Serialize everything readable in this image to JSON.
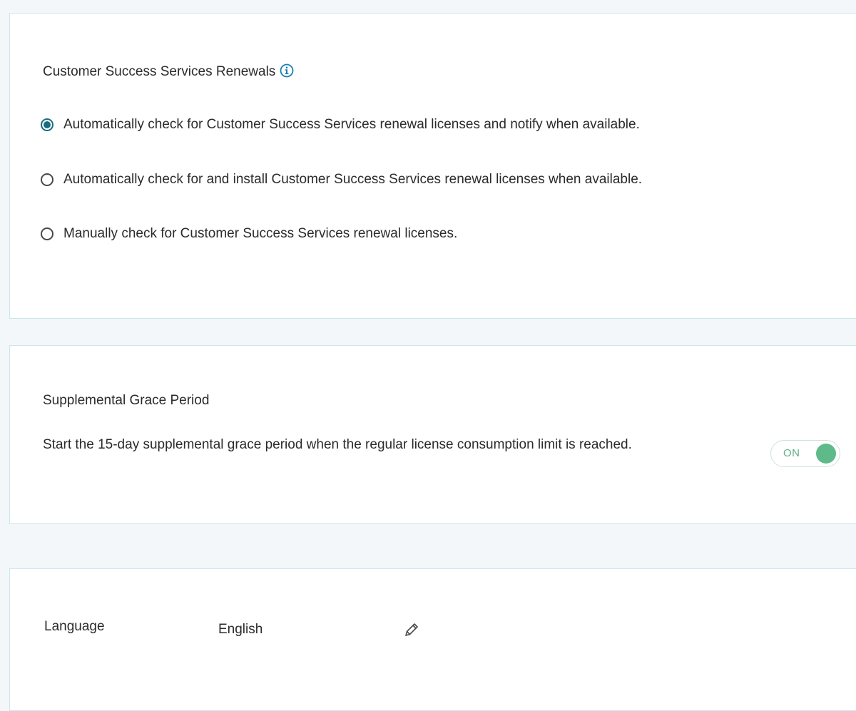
{
  "renewals": {
    "title": "Customer Success Services Renewals",
    "info_icon": "info-icon",
    "options": [
      {
        "label": "Automatically check for Customer Success Services renewal licenses and notify when available.",
        "checked": true
      },
      {
        "label": "Automatically check for and install Customer Success Services renewal licenses when available.",
        "checked": false
      },
      {
        "label": "Manually check for Customer Success Services renewal licenses.",
        "checked": false
      }
    ]
  },
  "grace": {
    "title": "Supplemental Grace Period",
    "description": "Start the 15-day supplemental grace period when the regular license consumption limit is reached.",
    "toggle_label": "ON",
    "toggle_on": true
  },
  "language": {
    "label": "Language",
    "value": "English",
    "edit_icon": "pencil-icon"
  },
  "colors": {
    "accent": "#1a6d80",
    "toggle_on": "#5fba89",
    "panel_border": "#cbe6ef",
    "page_bg": "#f4f7f9"
  }
}
